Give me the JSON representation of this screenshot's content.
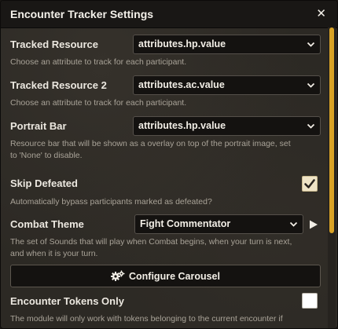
{
  "window": {
    "title": "Encounter Tracker Settings",
    "close_label": "✕"
  },
  "settings": {
    "tracked_resource": {
      "label": "Tracked Resource",
      "value": "attributes.hp.value",
      "hint": "Choose an attribute to track for each participant."
    },
    "tracked_resource_2": {
      "label": "Tracked Resource 2",
      "value": "attributes.ac.value",
      "hint": "Choose an attribute to track for each participant."
    },
    "portrait_bar": {
      "label": "Portrait Bar",
      "value": "attributes.hp.value",
      "hint_line1": "Resource bar that will be shown as a overlay on top of the portrait image, set",
      "hint_line2": "to 'None' to disable."
    },
    "skip_defeated": {
      "label": "Skip Defeated",
      "checked": true,
      "hint": "Automatically bypass participants marked as defeated?"
    },
    "combat_theme": {
      "label": "Combat Theme",
      "value": "Fight Commentator",
      "hint_line1": "The set of Sounds that will play when Combat begins, when your turn is next,",
      "hint_line2": "and when it is your turn."
    },
    "configure_carousel": {
      "label": "Configure Carousel",
      "icon": "cogs-icon"
    },
    "encounter_tokens_only": {
      "label": "Encounter Tokens Only",
      "checked": false,
      "hint": "The module will only work with tokens belonging to the current encounter if"
    }
  },
  "colors": {
    "accent_scrollbar": "#d9a326",
    "checkbox_checked": "#efe4c6"
  },
  "scroll": {
    "thumb_fraction": 0.68
  }
}
